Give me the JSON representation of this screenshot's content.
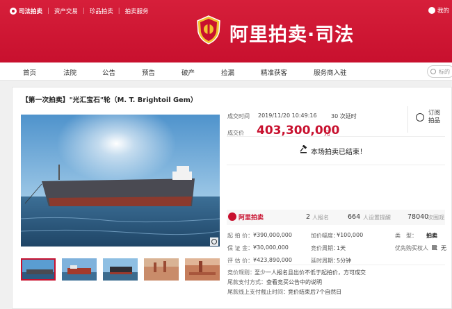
{
  "topbar": {
    "brand": "司法拍卖",
    "links": [
      "资产交易",
      "珍品拍卖",
      "拍卖服务"
    ],
    "right": "我的"
  },
  "logo_title": "阿里拍卖·司法",
  "nav": {
    "items": [
      "首页",
      "法院",
      "公告",
      "预告",
      "破产",
      "捡漏",
      "精准获客",
      "服务商入驻"
    ],
    "search_placeholder": "标的"
  },
  "item": {
    "title": "【第一次拍卖】\"光汇宝石\"轮（M. T. Brightoil Gem）",
    "deal_time_label": "成交时间",
    "deal_time": "2019/11/20 10:49:16",
    "delay": "30 次延时",
    "deal_price_label": "成交价",
    "deal_price": "403,300,000",
    "currency": "元",
    "subscribe": "订阅拍品",
    "ended": "本场拍卖已结束！"
  },
  "stats": {
    "brand": "阿里拍卖",
    "signups_count": "2",
    "signups_label": "人报名",
    "reminders_count": "664",
    "reminders_label": "人设置提醒",
    "views_count": "78040",
    "views_label": "次围观"
  },
  "details": {
    "start_price_label": "起 拍 价：",
    "start_price": "¥390,000,000",
    "deposit_label": "保 证 金：",
    "deposit": "¥30,000,000",
    "appraisal_label": "评 估 价：",
    "appraisal": "¥423,890,000",
    "increment_label": "加价幅度：",
    "increment": "¥100,000",
    "period_label": "竞价周期：",
    "period": "1天",
    "delay_period_label": "延时周期：",
    "delay_period": "5分钟",
    "type_label": "类　型：",
    "type": "拍卖",
    "priority_label": "优先购买权人",
    "priority": "：无"
  },
  "rules": {
    "rule1_label": "竞价规则：",
    "rule1": "至少一人报名且出价不低于起拍价，方可成交",
    "rule2_label": "尾款支付方式：",
    "rule2": "查看竞买公告中的说明",
    "rule3_label": "尾款线上支付截止时间：",
    "rule3": "竞价结束后7个自然日"
  },
  "colors": {
    "brand_red": "#c8102e",
    "sea": "#2e5a80",
    "sky": "#5a9dd2"
  }
}
